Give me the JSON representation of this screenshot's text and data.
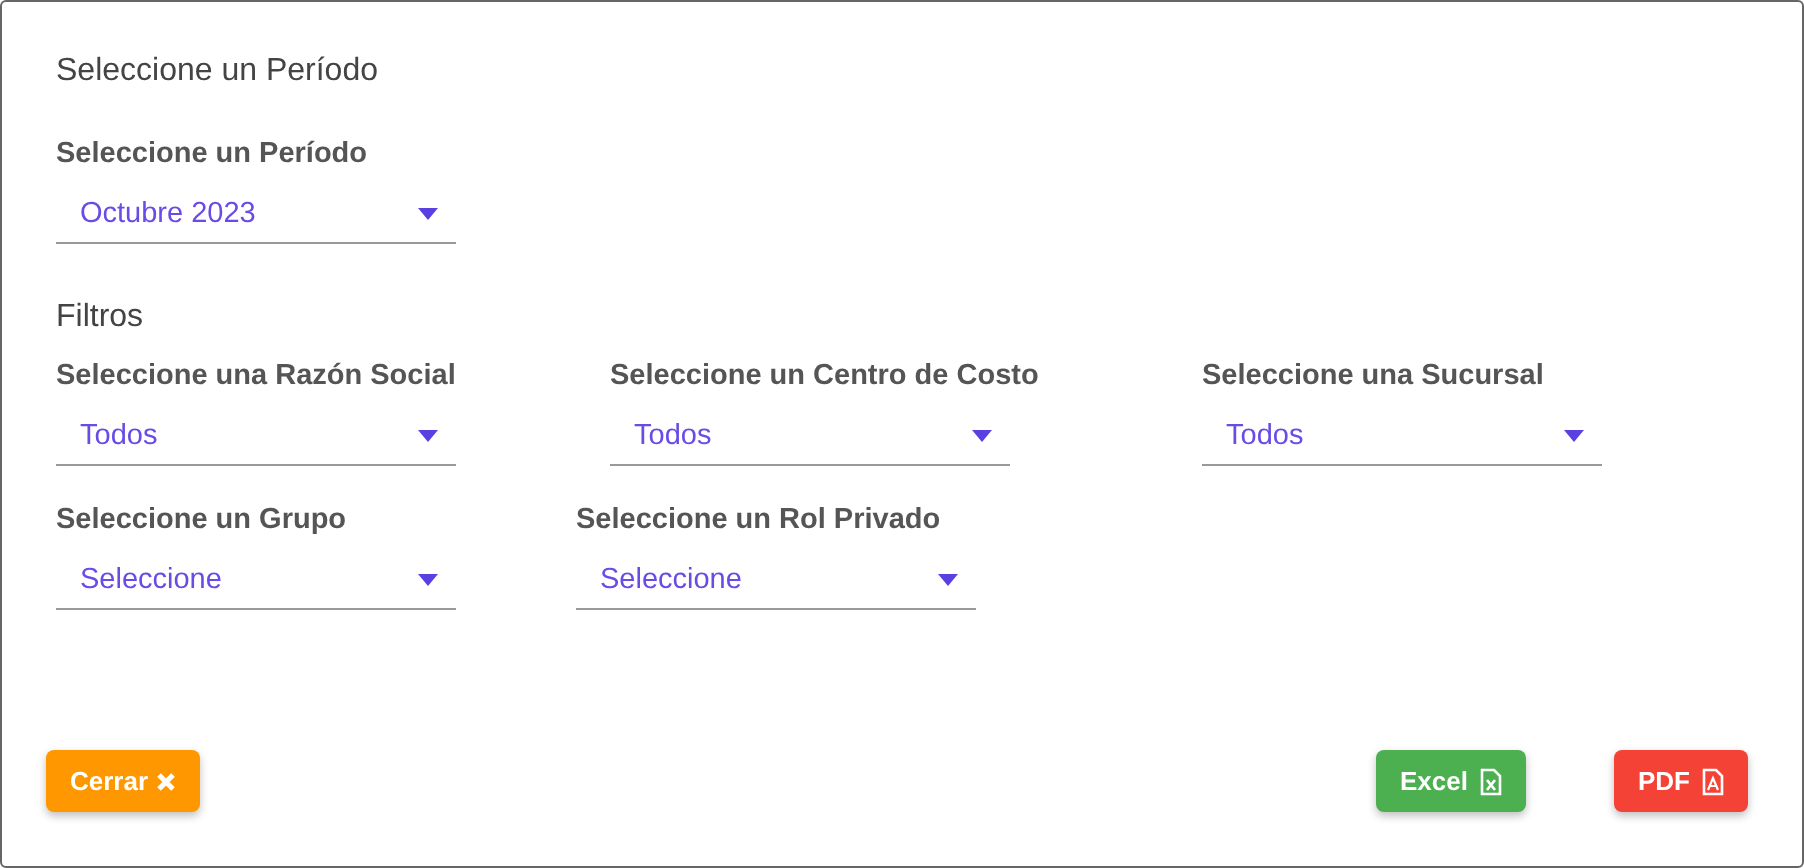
{
  "title": "Seleccione un Período",
  "period": {
    "label": "Seleccione un Período",
    "value": "Octubre 2023"
  },
  "filters_title": "Filtros",
  "filter_rows": [
    [
      {
        "label": "Seleccione una Razón Social",
        "value": "Todos"
      },
      {
        "label": "Seleccione un Centro de Costo",
        "value": "Todos"
      },
      {
        "label": "Seleccione una Sucursal",
        "value": "Todos"
      }
    ],
    [
      {
        "label": "Seleccione un Grupo",
        "value": "Seleccione"
      },
      {
        "label": "Seleccione un Rol Privado",
        "value": "Seleccione"
      }
    ]
  ],
  "buttons": [
    {
      "label": "Cerrar",
      "kind": "close"
    },
    {
      "label": "Excel",
      "kind": "excel"
    },
    {
      "label": "PDF",
      "kind": "pdf"
    }
  ]
}
